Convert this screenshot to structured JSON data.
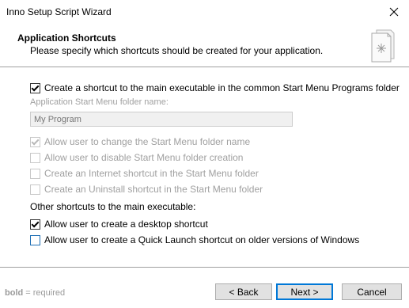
{
  "window": {
    "title": "Inno Setup Script Wizard"
  },
  "header": {
    "title": "Application Shortcuts",
    "subtitle": "Please specify which shortcuts should be created for your application.",
    "icon": "wizard-document-icon"
  },
  "start_menu": {
    "main_checkbox": {
      "label": "Create a shortcut to the main executable in the common Start Menu Programs folder",
      "checked": true
    },
    "folder_label": "Application Start Menu folder name:",
    "folder_value": "My Program",
    "options": [
      {
        "label": "Allow user to change the Start Menu folder name",
        "checked": true,
        "disabled": true
      },
      {
        "label": "Allow user to disable Start Menu folder creation",
        "checked": false,
        "disabled": true
      },
      {
        "label": "Create an Internet shortcut in the Start Menu folder",
        "checked": false,
        "disabled": true
      },
      {
        "label": "Create an Uninstall shortcut in the Start Menu folder",
        "checked": false,
        "disabled": true
      }
    ]
  },
  "other": {
    "label": "Other shortcuts to the main executable:",
    "options": [
      {
        "label": "Allow user to create a desktop shortcut",
        "checked": true
      },
      {
        "label": "Allow user to create a Quick Launch shortcut on older versions of Windows",
        "checked": false
      }
    ]
  },
  "footer": {
    "legend_bold": "bold",
    "legend_rest": " = required",
    "back_label": "< Back",
    "next_label": "Next >",
    "cancel_label": "Cancel"
  }
}
